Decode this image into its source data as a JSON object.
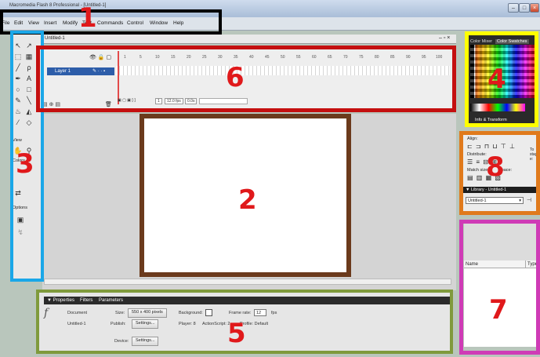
{
  "app": {
    "title": "Macromedia Flash 8 Professional - [Untitled-1]",
    "window_buttons": [
      "–",
      "□",
      "×"
    ]
  },
  "menu": [
    "File",
    "Edit",
    "View",
    "Insert",
    "Modify",
    "Text",
    "Commands",
    "Control",
    "Window",
    "Help"
  ],
  "document_tab": "Untitled-1",
  "timeline": {
    "layer_name": "Layer 1",
    "ruler": [
      "1",
      "5",
      "10",
      "15",
      "20",
      "25",
      "30",
      "35",
      "40",
      "45",
      "50",
      "55",
      "60",
      "65",
      "70",
      "75",
      "80",
      "85",
      "90",
      "95",
      "100"
    ],
    "frame": "1",
    "fps": "12.0 fps",
    "time": "0.0s"
  },
  "tools_labels": {
    "view": "View",
    "colors": "Colors",
    "options": "Options"
  },
  "properties": {
    "tabs": [
      "Properties",
      "Filters",
      "Parameters"
    ],
    "doc_type": "Document",
    "doc_name": "Untitled-1",
    "size_label": "Size:",
    "size_value": "550 x 400 pixels",
    "background_label": "Background:",
    "frame_rate_label": "Frame rate:",
    "frame_rate_value": "12",
    "fps_unit": "fps",
    "publish_label": "Publish:",
    "settings_label": "Settings...",
    "player_text": "Player: 8",
    "actionscript_text": "ActionScript: 2",
    "profile_text": "Profile: Default",
    "device_label": "Device:",
    "device_settings_label": "Settings..."
  },
  "color_panel": {
    "tab_mixer": "Color Mixer",
    "tab_swatches": "Color Swatches",
    "footer": "Info & Transform"
  },
  "align_panel": {
    "title": "Align:",
    "distribute": "Distribute:",
    "match_size": "Match size:",
    "space": "Space:",
    "to_stage": "To stage:"
  },
  "library": {
    "title": "Library - Untitled-1",
    "selected": "Untitled-1",
    "col_name": "Name",
    "col_type": "Type"
  },
  "annotations": {
    "labels": [
      "1",
      "2",
      "3",
      "4",
      "5",
      "6",
      "7",
      "8"
    ],
    "colors": {
      "1": "#000000",
      "2": "#6b3a1c",
      "3": "#1aa7e8",
      "4": "#ffff00",
      "5": "#7f9a3c",
      "6": "#c40f0f",
      "7": "#cf3bb6",
      "8": "#e07a1c"
    },
    "number_color": "#e0191b"
  },
  "icons": [
    "flash-logo-icon",
    "arrow-tool-icon",
    "subselect-icon",
    "lasso-icon",
    "pen-icon",
    "text-icon",
    "line-icon",
    "rect-icon",
    "pencil-icon",
    "brush-icon",
    "fill-icon",
    "eraser-icon"
  ]
}
